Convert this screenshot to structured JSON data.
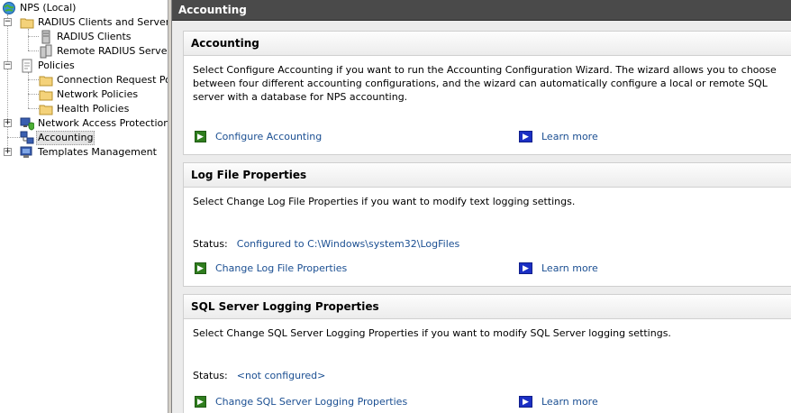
{
  "tree": {
    "root": "NPS (Local)",
    "radius_clients_servers": "RADIUS Clients and Servers",
    "radius_clients": "RADIUS Clients",
    "remote_radius": "Remote RADIUS Server G",
    "policies": "Policies",
    "connection_request": "Connection Request Polici",
    "network_policies": "Network Policies",
    "health_policies": "Health Policies",
    "nap": "Network Access Protection",
    "accounting": "Accounting",
    "templates": "Templates Management",
    "expand_minus": "−",
    "expand_plus": "+"
  },
  "content": {
    "header": "Accounting",
    "accounting": {
      "title": "Accounting",
      "description": "Select Configure Accounting if you want to run the Accounting Configuration Wizard. The wizard allows you to choose between four different accounting configurations, and the wizard can automatically configure a local or remote SQL server with a database for NPS accounting.",
      "action": "Configure Accounting",
      "learn_more": "Learn more"
    },
    "log_file": {
      "title": "Log File Properties",
      "description": "Select Change Log File Properties if you want to modify text logging settings.",
      "status_label": "Status:",
      "status_value": "Configured to C:\\Windows\\system32\\LogFiles",
      "action": "Change Log File Properties",
      "learn_more": "Learn more"
    },
    "sql": {
      "title": "SQL Server Logging Properties",
      "description": "Select Change SQL Server Logging Properties if you want to modify SQL Server logging settings.",
      "status_label": "Status:",
      "status_value": "<not configured>",
      "action": "Change SQL Server Logging Properties",
      "learn_more": "Learn more"
    }
  },
  "icons": {
    "arrow": "▶",
    "green": "#2f7d1e",
    "blue": "#1b2fc4",
    "link_color": "#1b4f92"
  }
}
